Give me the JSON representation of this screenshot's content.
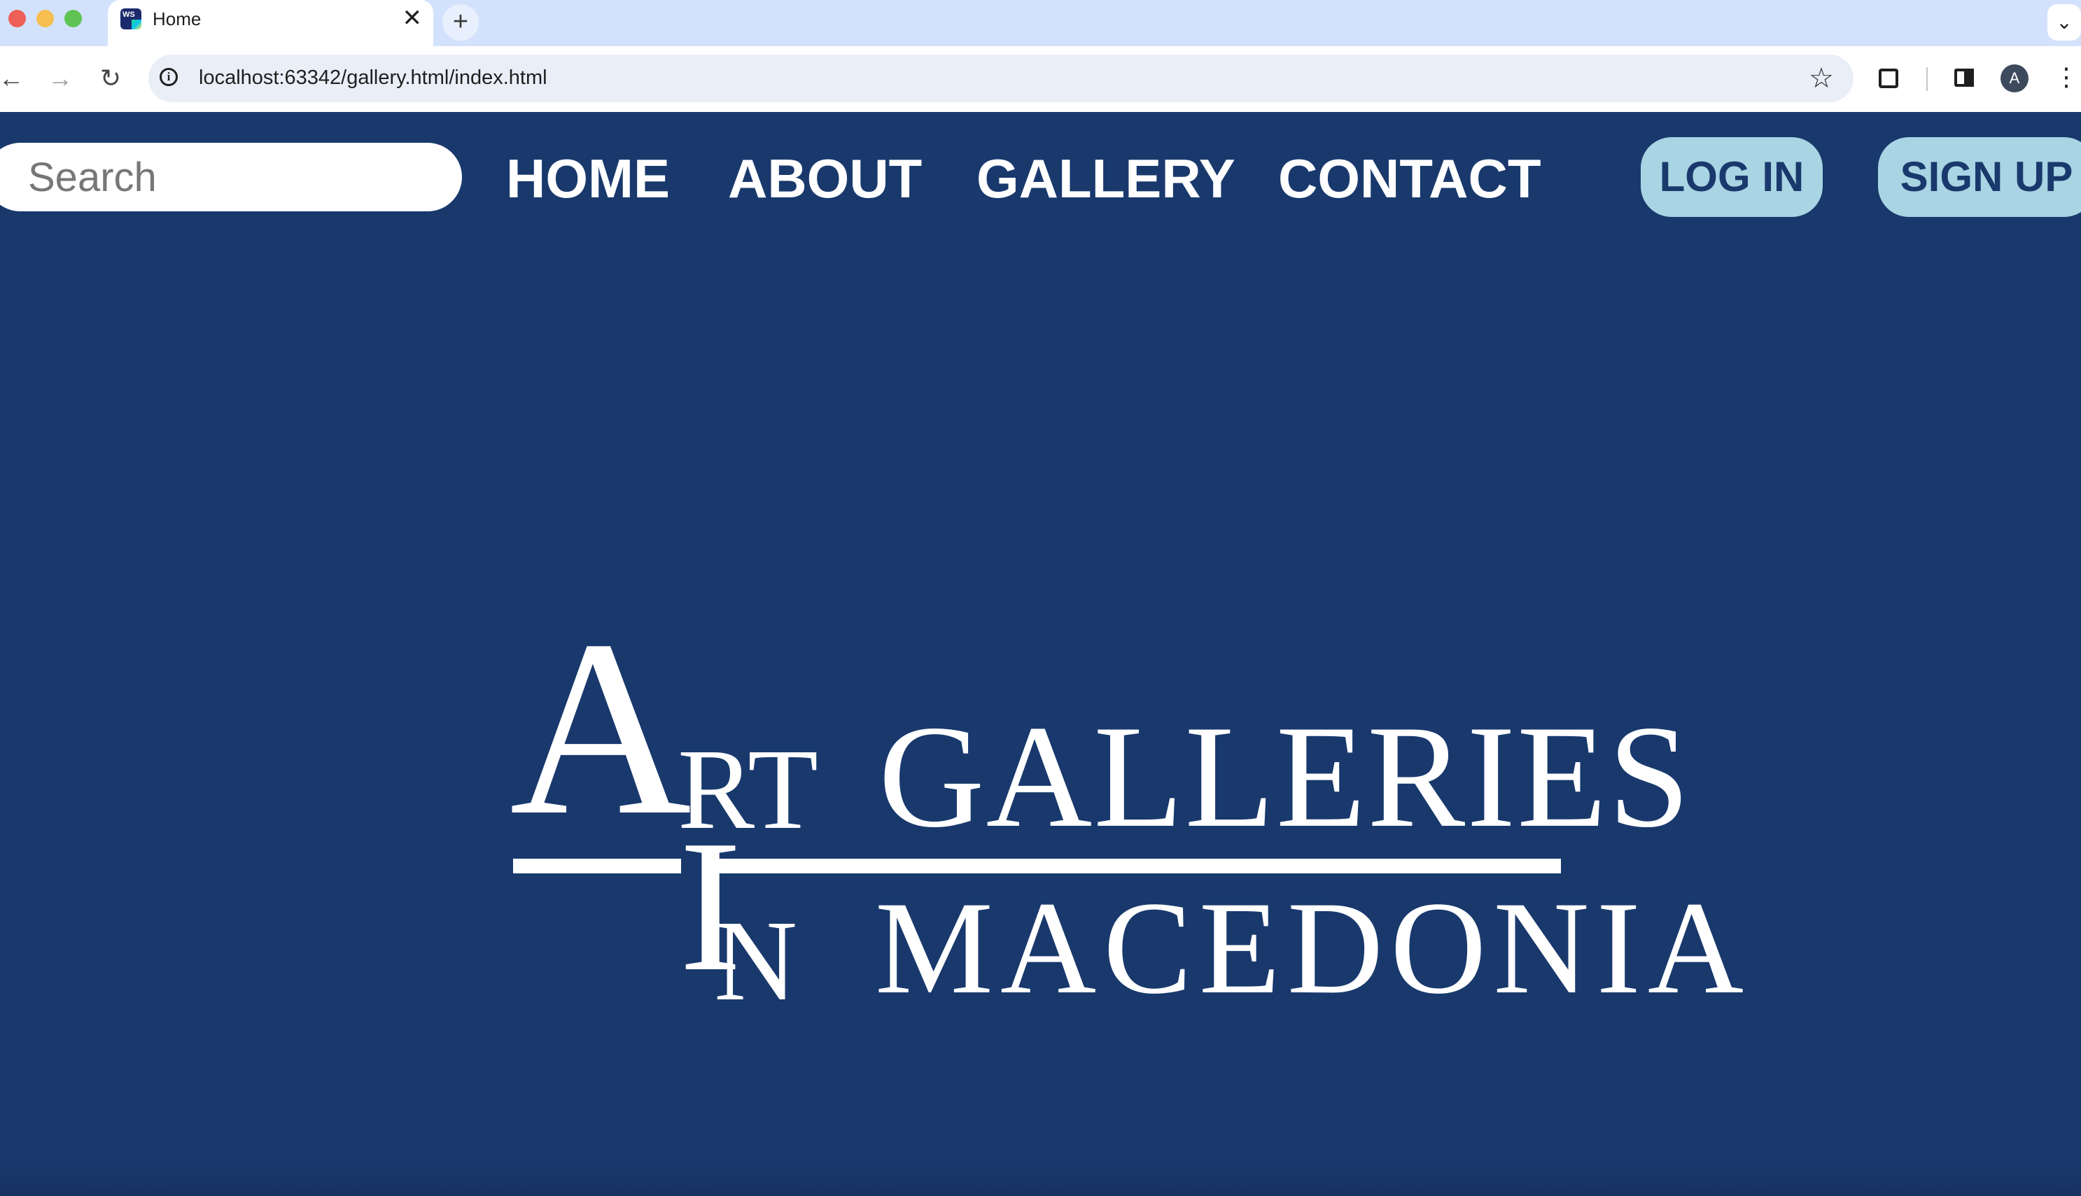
{
  "browser": {
    "tab_title": "Home",
    "tab_close_glyph": "✕",
    "new_tab_glyph": "+",
    "tab_menu_glyph": "⌄",
    "url": "localhost:63342/gallery.html/index.html",
    "profile_initial": "A",
    "icons": [
      "back-arrow-icon",
      "forward-arrow-icon",
      "reload-icon",
      "site-info-icon",
      "bookmark-star-icon",
      "extensions-icon",
      "side-panel-icon",
      "kebab-menu-icon"
    ]
  },
  "header": {
    "search_placeholder": "Search",
    "nav": {
      "home": "HOME",
      "about": "ABOUT",
      "gallery": "GALLERY",
      "contact": "CONTACT"
    },
    "login_label": "LOG IN",
    "signup_label": "SIGN UP"
  },
  "logo": {
    "art_initial": "A",
    "art_rest": "RT",
    "galleries": "GALLERIES",
    "in_initial": "I",
    "in_rest": "N",
    "macedonia": "MACEDONIA"
  },
  "colors": {
    "page_background": "#19396d",
    "button_background": "#a8d4e3",
    "button_text": "#19396d",
    "nav_text": "#ffffff",
    "tabstrip": "#d3e2fc"
  }
}
